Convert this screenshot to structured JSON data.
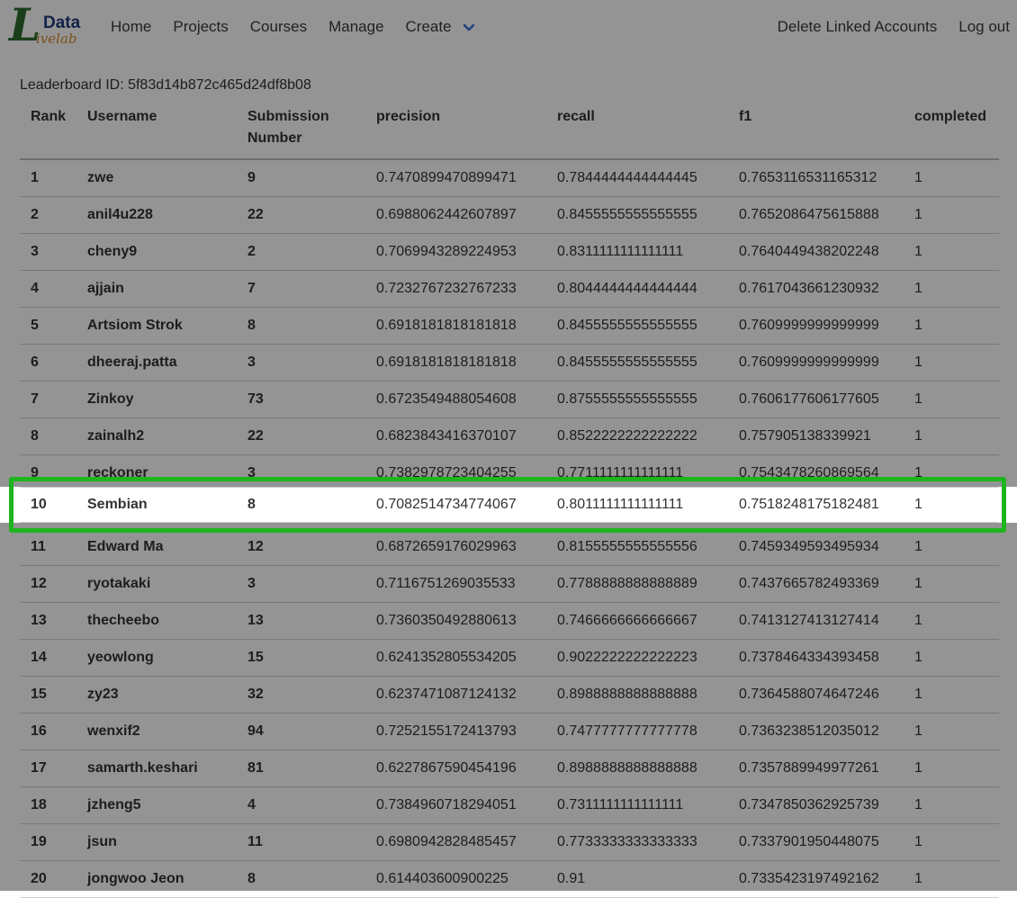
{
  "logo": {
    "letter": "L",
    "top": "Data",
    "bottom": "ivelab"
  },
  "nav": {
    "left": [
      "Home",
      "Projects",
      "Courses",
      "Manage",
      "Create"
    ],
    "right": [
      "Delete Linked Accounts",
      "Log out"
    ]
  },
  "leaderboard_id": "Leaderboard ID: 5f83d14b872c465d24df8b08",
  "columns": [
    "Rank",
    "Username",
    "Submission Number",
    "precision",
    "recall",
    "f1",
    "completed"
  ],
  "rows": [
    [
      "1",
      "zwe",
      "9",
      "0.7470899470899471",
      "0.7844444444444445",
      "0.7653116531165312",
      "1"
    ],
    [
      "2",
      "anil4u228",
      "22",
      "0.6988062442607897",
      "0.8455555555555555",
      "0.7652086475615888",
      "1"
    ],
    [
      "3",
      "cheny9",
      "2",
      "0.7069943289224953",
      "0.8311111111111111",
      "0.7640449438202248",
      "1"
    ],
    [
      "4",
      "ajjain",
      "7",
      "0.7232767232767233",
      "0.8044444444444444",
      "0.7617043661230932",
      "1"
    ],
    [
      "5",
      "Artsiom Strok",
      "8",
      "0.6918181818181818",
      "0.8455555555555555",
      "0.7609999999999999",
      "1"
    ],
    [
      "6",
      "dheeraj.patta",
      "3",
      "0.6918181818181818",
      "0.8455555555555555",
      "0.7609999999999999",
      "1"
    ],
    [
      "7",
      "Zinkoy",
      "73",
      "0.6723549488054608",
      "0.8755555555555555",
      "0.7606177606177605",
      "1"
    ],
    [
      "8",
      "zainalh2",
      "22",
      "0.6823843416370107",
      "0.8522222222222222",
      "0.757905138339921",
      "1"
    ],
    [
      "9",
      "reckoner",
      "3",
      "0.7382978723404255",
      "0.7711111111111111",
      "0.7543478260869564",
      "1"
    ],
    [
      "10",
      "Sembian",
      "8",
      "0.7082514734774067",
      "0.8011111111111111",
      "0.7518248175182481",
      "1"
    ],
    [
      "11",
      "Edward Ma",
      "12",
      "0.6872659176029963",
      "0.8155555555555556",
      "0.7459349593495934",
      "1"
    ],
    [
      "12",
      "ryotakaki",
      "3",
      "0.7116751269035533",
      "0.7788888888888889",
      "0.7437665782493369",
      "1"
    ],
    [
      "13",
      "thecheebo",
      "13",
      "0.7360350492880613",
      "0.7466666666666667",
      "0.7413127413127414",
      "1"
    ],
    [
      "14",
      "yeowlong",
      "15",
      "0.6241352805534205",
      "0.9022222222222223",
      "0.7378464334393458",
      "1"
    ],
    [
      "15",
      "zy23",
      "32",
      "0.6237471087124132",
      "0.8988888888888888",
      "0.7364588074647246",
      "1"
    ],
    [
      "16",
      "wenxif2",
      "94",
      "0.7252155172413793",
      "0.7477777777777778",
      "0.7363238512035012",
      "1"
    ],
    [
      "17",
      "samarth.keshari",
      "81",
      "0.6227867590454196",
      "0.8988888888888888",
      "0.7357889949977261",
      "1"
    ],
    [
      "18",
      "jzheng5",
      "4",
      "0.7384960718294051",
      "0.7311111111111111",
      "0.7347850362925739",
      "1"
    ],
    [
      "19",
      "jsun",
      "11",
      "0.6980942828485457",
      "0.7733333333333333",
      "0.7337901950448075",
      "1"
    ],
    [
      "20",
      "jongwoo Jeon",
      "8",
      "0.614403600900225",
      "0.91",
      "0.7335423197492162",
      "1"
    ]
  ],
  "highlight": {
    "row_index": 9,
    "border_color": "#1db51d"
  }
}
